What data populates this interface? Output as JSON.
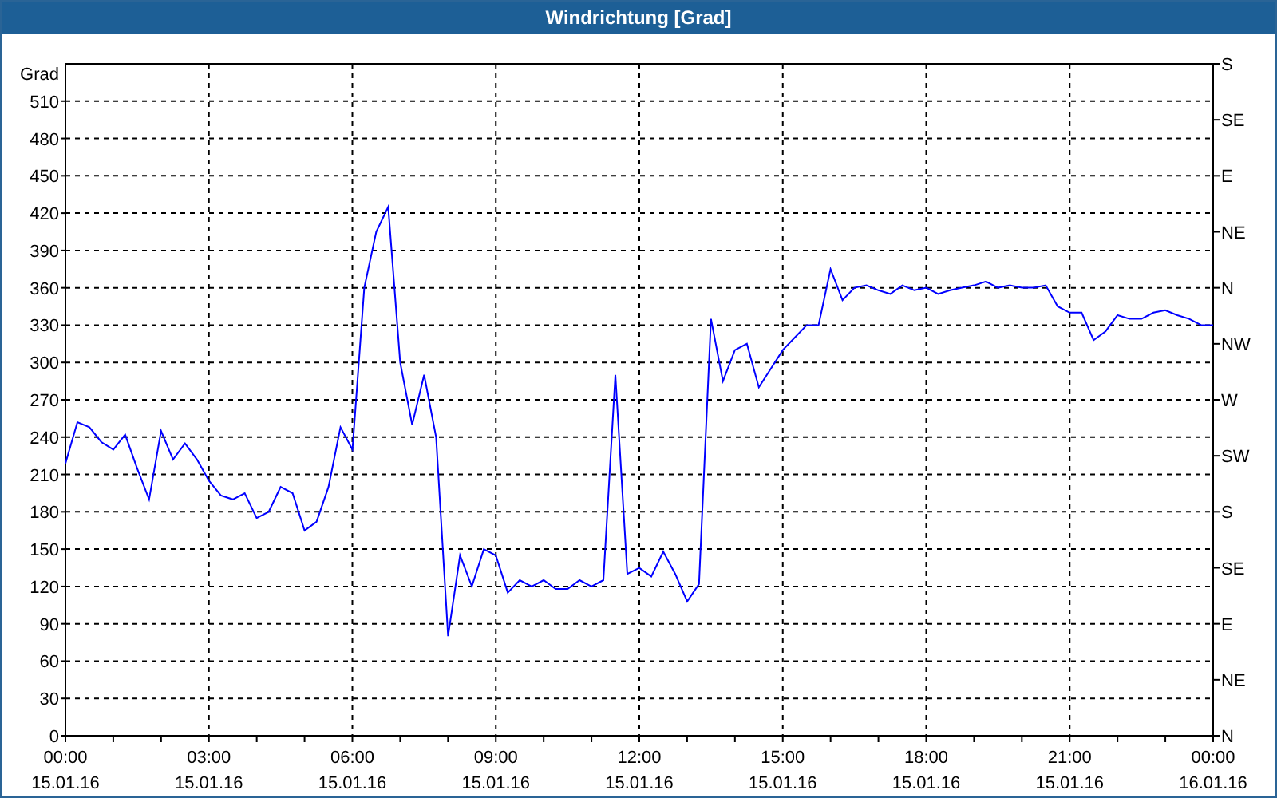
{
  "window": {
    "title": "Windrichtung [Grad]"
  },
  "chart": {
    "right_axis_labels": [
      "S",
      "SE",
      "E",
      "NE",
      "N",
      "NW",
      "W",
      "SW",
      "S",
      "SE",
      "E",
      "NE",
      "N"
    ],
    "x_dates": [
      "15.01.16",
      "15.01.16",
      "15.01.16",
      "15.01.16",
      "15.01.16",
      "15.01.16",
      "15.01.16",
      "15.01.16",
      "16.01.16"
    ],
    "chart_data": {
      "type": "line",
      "grid": true,
      "ylabel": "Grad",
      "xlim": [
        0,
        24
      ],
      "ylim": [
        0,
        540
      ],
      "yticks": [
        0,
        30,
        60,
        90,
        120,
        150,
        180,
        210,
        240,
        270,
        300,
        330,
        360,
        390,
        420,
        450,
        480,
        510
      ],
      "xticks": [
        {
          "value": 0,
          "label": "00:00"
        },
        {
          "value": 3,
          "label": "03:00"
        },
        {
          "value": 6,
          "label": "06:00"
        },
        {
          "value": 9,
          "label": "09:00"
        },
        {
          "value": 12,
          "label": "12:00"
        },
        {
          "value": 15,
          "label": "15:00"
        },
        {
          "value": 18,
          "label": "18:00"
        },
        {
          "value": 21,
          "label": "21:00"
        },
        {
          "value": 24,
          "label": "00:00"
        }
      ],
      "x": [
        0,
        0.25,
        0.5,
        0.75,
        1,
        1.25,
        1.5,
        1.75,
        2,
        2.25,
        2.5,
        2.75,
        3,
        3.25,
        3.5,
        3.75,
        4,
        4.25,
        4.5,
        4.75,
        5,
        5.25,
        5.5,
        5.75,
        6,
        6.25,
        6.5,
        6.75,
        7,
        7.25,
        7.5,
        7.75,
        8,
        8.25,
        8.5,
        8.75,
        9,
        9.25,
        9.5,
        9.75,
        10,
        10.25,
        10.5,
        10.75,
        11,
        11.25,
        11.5,
        11.75,
        12,
        12.25,
        12.5,
        12.75,
        13,
        13.25,
        13.5,
        13.75,
        14,
        14.25,
        14.5,
        14.75,
        15,
        15.25,
        15.5,
        15.75,
        16,
        16.25,
        16.5,
        16.75,
        17,
        17.25,
        17.5,
        17.75,
        18,
        18.25,
        18.5,
        18.75,
        19,
        19.25,
        19.5,
        19.75,
        20,
        20.25,
        20.5,
        20.75,
        21,
        21.25,
        21.5,
        21.75,
        22,
        22.25,
        22.5,
        22.75,
        23,
        23.25,
        23.5,
        23.75,
        24
      ],
      "series": [
        {
          "color": "#0000ff",
          "values": [
            219,
            252,
            248,
            236,
            230,
            242,
            215,
            190,
            245,
            222,
            235,
            222,
            205,
            193,
            190,
            195,
            175,
            180,
            200,
            195,
            165,
            172,
            200,
            248,
            230,
            360,
            405,
            425,
            300,
            250,
            290,
            240,
            80,
            145,
            120,
            150,
            145,
            115,
            125,
            120,
            125,
            118,
            118,
            125,
            120,
            125,
            290,
            130,
            135,
            128,
            148,
            130,
            108,
            122,
            335,
            285,
            310,
            315,
            280,
            295,
            310,
            320,
            330,
            330,
            375,
            350,
            360,
            362,
            358,
            355,
            362,
            358,
            360,
            355,
            358,
            360,
            362,
            365,
            360,
            362,
            360,
            360,
            362,
            345,
            340,
            340,
            318,
            325,
            338,
            335,
            335,
            340,
            342,
            338,
            335,
            330,
            330
          ]
        }
      ]
    }
  }
}
